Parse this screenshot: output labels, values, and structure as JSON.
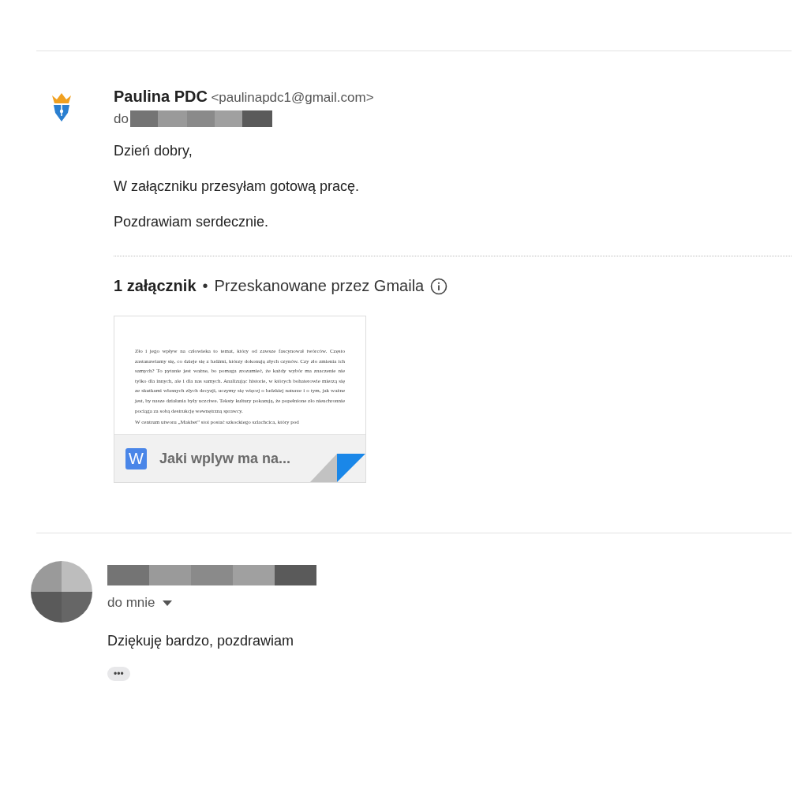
{
  "messages": [
    {
      "sender": {
        "name": "Paulina PDC",
        "email": "<paulinapdc1@gmail.com>"
      },
      "recipient_prefix": "do",
      "body": [
        "Dzień dobry,",
        "W załączniku przesyłam gotową pracę.",
        "Pozdrawiam serdecznie."
      ],
      "attachments": {
        "count_label": "1 załącznik",
        "separator": "•",
        "scan_note": "Przeskanowane przez Gmaila",
        "files": [
          {
            "kind": "word",
            "icon_letter": "W",
            "name": "Jaki wplyw ma na...",
            "preview": [
              "Zło i jego wpływ na człowieka to temat, który od zawsze fascynował twórców. Często zastanawiamy się, co dzieje się z ludźmi, którzy dokonują złych czynów. Czy zło zmienia ich samych? To pytanie jest ważne, bo pomaga zrozumieć, że każdy wybór ma znaczenie nie tylko dla innych, ale i dla nas samych. Analizując historie, w których bohaterowie mierzą się ze skutkami własnych złych decyzji, uczymy się więcej o ludzkiej naturze i o tym, jak ważne jest, by nasze działania były uczciwe. Teksty kultury pokazują, że popełnione zło nieuchronnie pociąga za sobą destrukcję wewnętrzną sprawcy.",
              "W centrum utworu „Makbet” stoi postać szkockiego szlachcica, który pod"
            ]
          }
        ]
      }
    },
    {
      "recipient": "do mnie",
      "body": [
        "Dziękuję bardzo, pozdrawiam"
      ],
      "more_label": "•••"
    }
  ]
}
